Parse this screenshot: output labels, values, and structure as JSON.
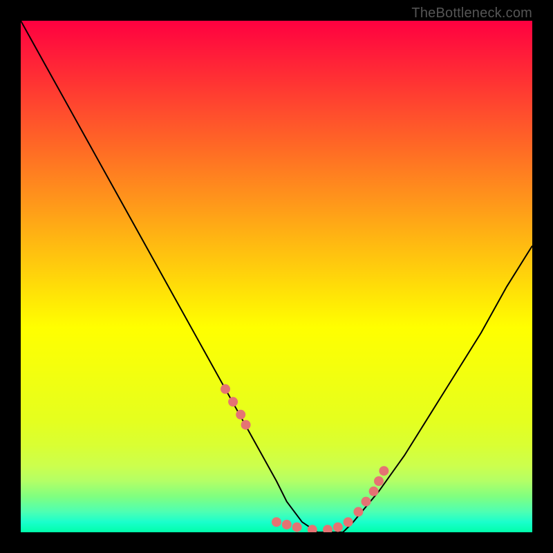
{
  "watermark": "TheBottleneck.com",
  "colors": {
    "curve": "#000000",
    "markers": "#e57373",
    "background": "#000000"
  },
  "chart_data": {
    "type": "line",
    "title": "",
    "xlabel": "",
    "ylabel": "",
    "xlim": [
      0,
      100
    ],
    "ylim": [
      0,
      100
    ],
    "grid": false,
    "legend": false,
    "series": [
      {
        "name": "bottleneck-curve",
        "x": [
          0,
          5,
          10,
          15,
          20,
          25,
          30,
          35,
          40,
          45,
          50,
          52,
          55,
          58,
          60,
          63,
          65,
          70,
          75,
          80,
          85,
          90,
          95,
          100
        ],
        "values": [
          100,
          91,
          82,
          73,
          64,
          55,
          46,
          37,
          28,
          19,
          10,
          6,
          2,
          0,
          0,
          0,
          2,
          8,
          15,
          23,
          31,
          39,
          48,
          56
        ]
      }
    ],
    "markers": {
      "name": "highlight-points",
      "x": [
        40,
        41.5,
        43,
        44,
        50,
        52,
        54,
        57,
        60,
        62,
        64,
        66,
        67.5,
        69,
        70,
        71
      ],
      "values": [
        28,
        25.5,
        23,
        21,
        2,
        1.5,
        1,
        0.5,
        0.5,
        1,
        2,
        4,
        6,
        8,
        10,
        12
      ]
    }
  }
}
